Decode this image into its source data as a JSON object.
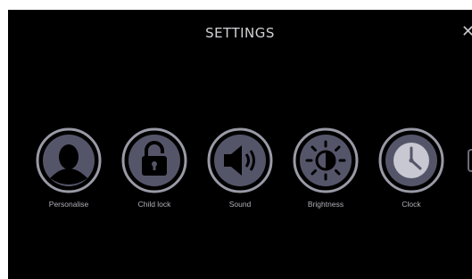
{
  "header": {
    "title": "SETTINGS",
    "close_glyph": "✕"
  },
  "settings": [
    {
      "label": "Personalise",
      "icon": "user-silhouette-icon"
    },
    {
      "label": "Child lock",
      "icon": "padlock-icon"
    },
    {
      "label": "Sound",
      "icon": "speaker-icon"
    },
    {
      "label": "Brightness",
      "icon": "brightness-icon"
    },
    {
      "label": "Clock",
      "icon": "clock-icon"
    }
  ],
  "colors": {
    "screen_bg": "#000000",
    "icon_fill": "#55556a",
    "icon_ring": "#9a9aa6",
    "glyph": "#000000",
    "text": "#d2d2d6"
  }
}
